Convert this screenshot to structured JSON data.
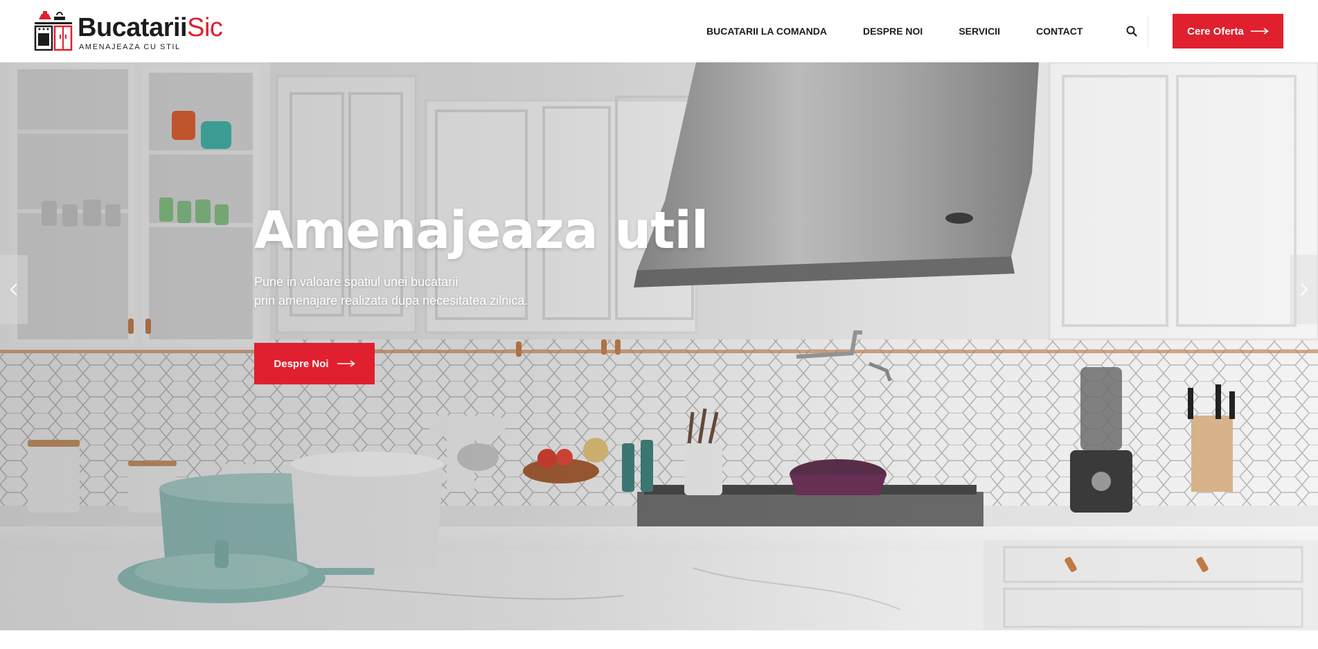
{
  "brand": {
    "name_dark": "Bucatarii",
    "name_red": "Sic",
    "tagline": "AMENAJEAZA CU STIL"
  },
  "nav": {
    "items": [
      {
        "label": "BUCATARII LA COMANDA"
      },
      {
        "label": "DESPRE NOI"
      },
      {
        "label": "SERVICII"
      },
      {
        "label": "CONTACT"
      }
    ]
  },
  "header": {
    "search_icon": "search-icon",
    "cta_label": "Cere Oferta"
  },
  "hero": {
    "title": "Amenajeaza util",
    "subtitle_line1": "Pune in valoare spatiul unei bucatarii",
    "subtitle_line2": "prin amenajare realizata dupa necesitatea zilnica.",
    "button_label": "Despre Noi"
  },
  "colors": {
    "accent": "#e0202e",
    "text_dark": "#1c1c1c",
    "white": "#ffffff"
  },
  "icons": {
    "prev": "chevron-left-icon",
    "next": "chevron-right-icon",
    "arrow": "arrow-right-icon"
  }
}
